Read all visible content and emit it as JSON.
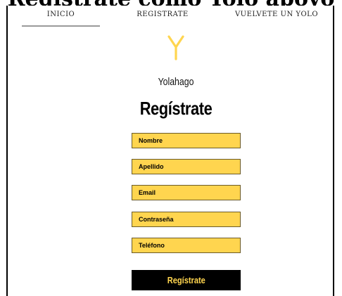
{
  "page": {
    "cropped_heading": "Registrate como Yolo apoyo"
  },
  "nav": {
    "items": [
      {
        "label": "INICIO"
      },
      {
        "label": "REGISTRATE"
      },
      {
        "label": "VUELVETE UN YOLO"
      }
    ]
  },
  "brand": {
    "logo_icon": "y-logo-icon",
    "name": "Yolahago",
    "accent_color": "#ffd54f"
  },
  "form": {
    "title": "Regístrate",
    "fields": [
      {
        "placeholder": "Nombre"
      },
      {
        "placeholder": "Apellido"
      },
      {
        "placeholder": "Email"
      },
      {
        "placeholder": "Contraseña"
      },
      {
        "placeholder": "Teléfono"
      }
    ],
    "submit_label": "Regístrate",
    "field_color": "#ffd54f",
    "button_color": "#000000"
  }
}
